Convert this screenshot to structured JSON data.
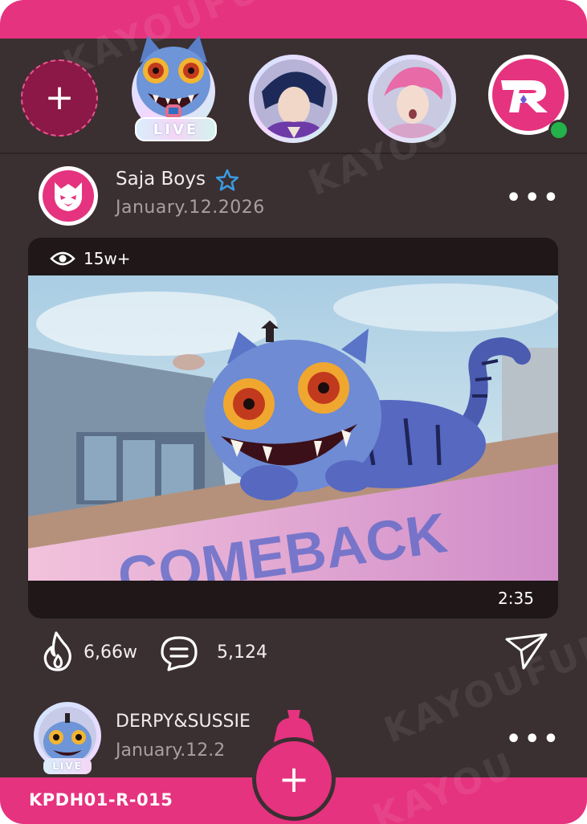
{
  "stories": {
    "add_symbol": "+",
    "live_label": "LIVE"
  },
  "post": {
    "author": "Saja Boys",
    "date": "January.12.2026",
    "more_symbol": "•••",
    "views": "15w+",
    "duration": "2:35",
    "likes": "6,66w",
    "comments": "5,124",
    "sign_text": "COMEBACK"
  },
  "next_post": {
    "author": "DERPY&SUSSIE",
    "date": "January.12.2",
    "live_label": "LIVE",
    "more_symbol": "•••"
  },
  "footer": {
    "card_code": "KPDH01-R-015",
    "add_symbol": "+"
  },
  "watermark": {
    "brand": "KAYOU",
    "brand2": "KAYOUFUN"
  },
  "colors": {
    "accent": "#e5337f",
    "panel": "#3a2f31",
    "online": "#24b24a"
  }
}
